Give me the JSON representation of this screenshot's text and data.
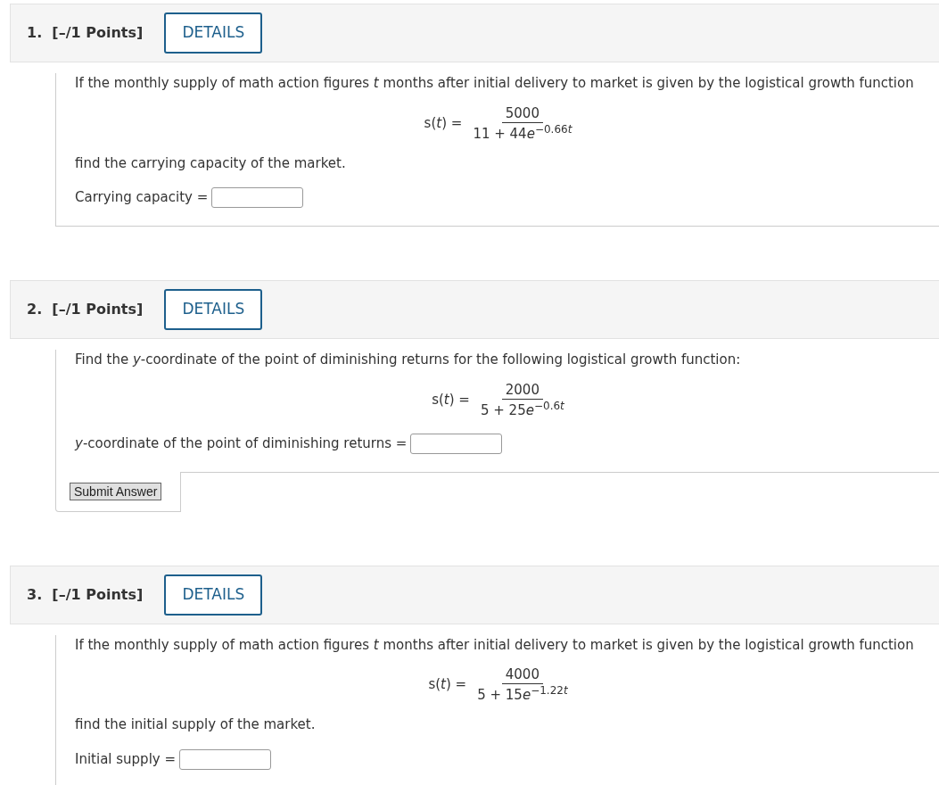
{
  "questions": [
    {
      "number": "1.",
      "points": "[–/1 Points]",
      "details_button": "DETAILS",
      "body": [
        {
          "kind": "paragraph",
          "text": "If the monthly supply of math action figures *t* months after initial delivery to market is given by the logistical growth function"
        },
        {
          "kind": "formula",
          "lhs": "s(*t*) =",
          "numerator": "5000",
          "denominator": "11 + 44",
          "base": "e",
          "exponent": "−0.66",
          "exponent_variable": "t"
        },
        {
          "kind": "paragraph",
          "text": "find the carrying capacity of the market."
        },
        {
          "kind": "answer",
          "label": "Carrying capacity ="
        }
      ]
    },
    {
      "number": "2.",
      "points": "[–/1 Points]",
      "details_button": "DETAILS",
      "body": [
        {
          "kind": "paragraph",
          "text": "Find the *y*-coordinate of the point of diminishing returns for the following logistical growth function:"
        },
        {
          "kind": "formula",
          "lhs": "s(*t*) =",
          "numerator": "2000",
          "denominator": "5 + 25",
          "base": "e",
          "exponent": "−0.6",
          "exponent_variable": "t"
        },
        {
          "kind": "answer",
          "label": "*y*-coordinate of the point of diminishing returns ="
        }
      ],
      "submit_button": "Submit Answer"
    },
    {
      "number": "3.",
      "points": "[–/1 Points]",
      "details_button": "DETAILS",
      "body": [
        {
          "kind": "paragraph",
          "text": "If the monthly supply of math action figures *t* months after initial delivery to market is given by the logistical growth function"
        },
        {
          "kind": "formula",
          "lhs": "s(*t*) =",
          "numerator": "4000",
          "denominator": "5 + 15",
          "base": "e",
          "exponent": "−1.22",
          "exponent_variable": "t"
        },
        {
          "kind": "paragraph",
          "text": "find the initial supply of the market."
        },
        {
          "kind": "answer",
          "label": "Initial supply ="
        }
      ]
    }
  ]
}
